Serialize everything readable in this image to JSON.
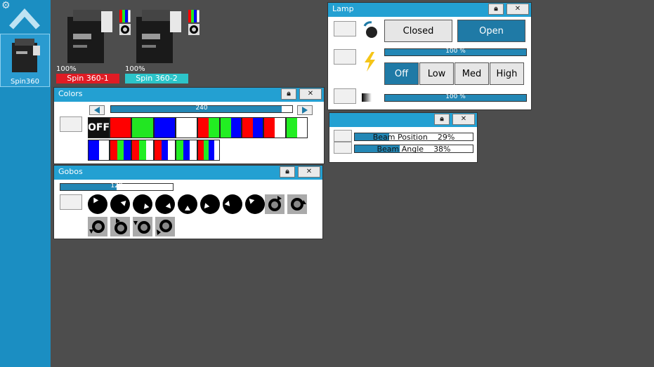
{
  "sidebar": {
    "fixture_label": "Spin360"
  },
  "devices": [
    {
      "percent": "100%",
      "name": "Spin 360-1",
      "color": "#e01b24"
    },
    {
      "percent": "100%",
      "name": "Spin 360-2",
      "color": "#2cc4c9"
    }
  ],
  "colors_panel": {
    "title": "Colors",
    "slider": {
      "value": "240",
      "fraction": 0.94
    },
    "off_label": "OFF",
    "palette": {
      "red": "#ff0000",
      "green": "#22e622",
      "blue": "#0000ff",
      "white": "#ffffff",
      "black": "#111111"
    }
  },
  "gobos_panel": {
    "title": "Gobos",
    "slider": {
      "value": "128",
      "fraction": 0.5
    }
  },
  "lamp_panel": {
    "title": "Lamp",
    "shutter": {
      "closed": "Closed",
      "open": "Open",
      "active": "Open"
    },
    "intensity_bar": {
      "text": "100 %",
      "fraction": 1.0
    },
    "modes": [
      "Off",
      "Low",
      "Med",
      "High"
    ],
    "active_mode": "Off",
    "dimmer_bar": {
      "text": "100 %",
      "fraction": 1.0
    }
  },
  "beam_panel": {
    "position": {
      "label": "Beam Position",
      "value": "29%",
      "fraction": 0.29
    },
    "angle": {
      "label": "Beam Angle",
      "value": "38%",
      "fraction": 0.38
    }
  },
  "colors": {
    "accent": "#23a0d2",
    "sidebar": "#1b8ec2",
    "background": "#4d4d4d",
    "active_button": "#1f7aa6"
  }
}
